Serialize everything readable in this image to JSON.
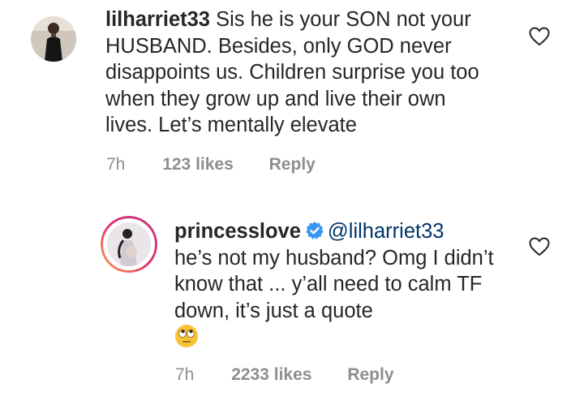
{
  "comments": [
    {
      "username": "lilharriet33",
      "text": "Sis he is your SON not your HUSBAND. Besides, only GOD never disappoints us. Children surprise you too when they grow up and live their own lives. Let’s mentally elevate",
      "time": "7h",
      "likes": "123 likes",
      "reply": "Reply",
      "avatar_icon": "profile-photo-woman-black-dress",
      "heart_icon": "heart-outline-icon"
    },
    {
      "username": "princesslove",
      "verified": true,
      "mention": "@lilharriet33",
      "text_line1_rest": "",
      "text": "he’s not my husband? Omg I didn’t know that ... y’all need to calm TF down, it’s just a quote",
      "emoji": "face-with-rolling-eyes",
      "time": "7h",
      "likes": "2233 likes",
      "reply": "Reply",
      "avatar_icon": "profile-photo-pregnant-woman-story-ring",
      "heart_icon": "heart-outline-icon"
    }
  ],
  "colors": {
    "text": "#262626",
    "meta": "#8e8e8e",
    "mention": "#003569",
    "verified": "#3897f0",
    "story_ring_start": "#f9a54b",
    "story_ring_end": "#c13584"
  }
}
